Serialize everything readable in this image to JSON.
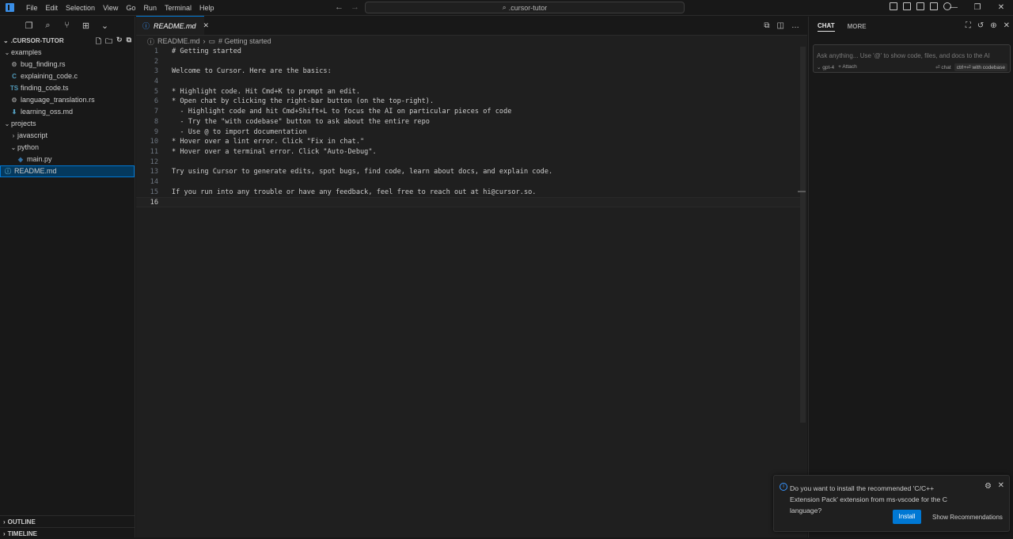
{
  "menu": [
    "File",
    "Edit",
    "Selection",
    "View",
    "Go",
    "Run",
    "Terminal",
    "Help"
  ],
  "search": {
    "text": ".cursor-tutor"
  },
  "sidebar": {
    "header": ".CURSOR-TUTOR",
    "tree": [
      {
        "label": "examples",
        "type": "folder",
        "open": true,
        "depth": 0
      },
      {
        "label": "bug_finding.rs",
        "type": "rs",
        "icon": "⚙",
        "color": "#8c8c8c",
        "depth": 1
      },
      {
        "label": "explaining_code.c",
        "type": "c",
        "icon": "C",
        "color": "#519aba",
        "depth": 1
      },
      {
        "label": "finding_code.ts",
        "type": "ts",
        "icon": "TS",
        "color": "#519aba",
        "depth": 1
      },
      {
        "label": "language_translation.rs",
        "type": "rs",
        "icon": "⚙",
        "color": "#8c8c8c",
        "depth": 1
      },
      {
        "label": "learning_oss.md",
        "type": "md",
        "icon": "⬇",
        "color": "#519aba",
        "depth": 1
      },
      {
        "label": "projects",
        "type": "folder",
        "open": true,
        "depth": 0
      },
      {
        "label": "javascript",
        "type": "folder",
        "open": false,
        "depth": 1
      },
      {
        "label": "python",
        "type": "folder",
        "open": true,
        "depth": 1
      },
      {
        "label": "main.py",
        "type": "py",
        "icon": "◆",
        "color": "#3572a5",
        "depth": 2
      },
      {
        "label": "README.md",
        "type": "md",
        "icon": "ⓘ",
        "color": "#519aba",
        "depth": 0,
        "selected": true
      }
    ],
    "outline": "OUTLINE",
    "timeline": "TIMELINE"
  },
  "editor": {
    "tab": "README.md",
    "breadcrumb_file": "README.md",
    "breadcrumb_section": "# Getting started",
    "lines": [
      "# Getting started",
      "",
      "Welcome to Cursor. Here are the basics:",
      "",
      "* Highlight code. Hit Cmd+K to prompt an edit.",
      "* Open chat by clicking the right-bar button (on the top-right).",
      "  - Highlight code and hit Cmd+Shift+L to focus the AI on particular pieces of code",
      "  - Try the \"with codebase\" button to ask about the entire repo",
      "  - Use @ to import documentation",
      "* Hover over a lint error. Click \"Fix in chat.\"",
      "* Hover over a terminal error. Click \"Auto-Debug\".",
      "",
      "Try using Cursor to generate edits, spot bugs, find code, learn about docs, and explain code.",
      "",
      "If you run into any trouble or have any feedback, feel free to reach out at hi@cursor.so.",
      ""
    ],
    "current_line": 16
  },
  "chat": {
    "tab_chat": "CHAT",
    "tab_more": "MORE",
    "placeholder": "Ask anything... Use '@' to show code, files, and docs to the AI",
    "model": "gpt-4",
    "attach": "+ Attach",
    "chat_hint": "⏎ chat",
    "codebase_kbd": "ctrl+⏎",
    "codebase_label": "with codebase"
  },
  "toast": {
    "message": "Do you want to install the recommended 'C/C++ Extension Pack' extension from ms-vscode for the C language?",
    "install": "Install",
    "show": "Show Recommendations"
  }
}
